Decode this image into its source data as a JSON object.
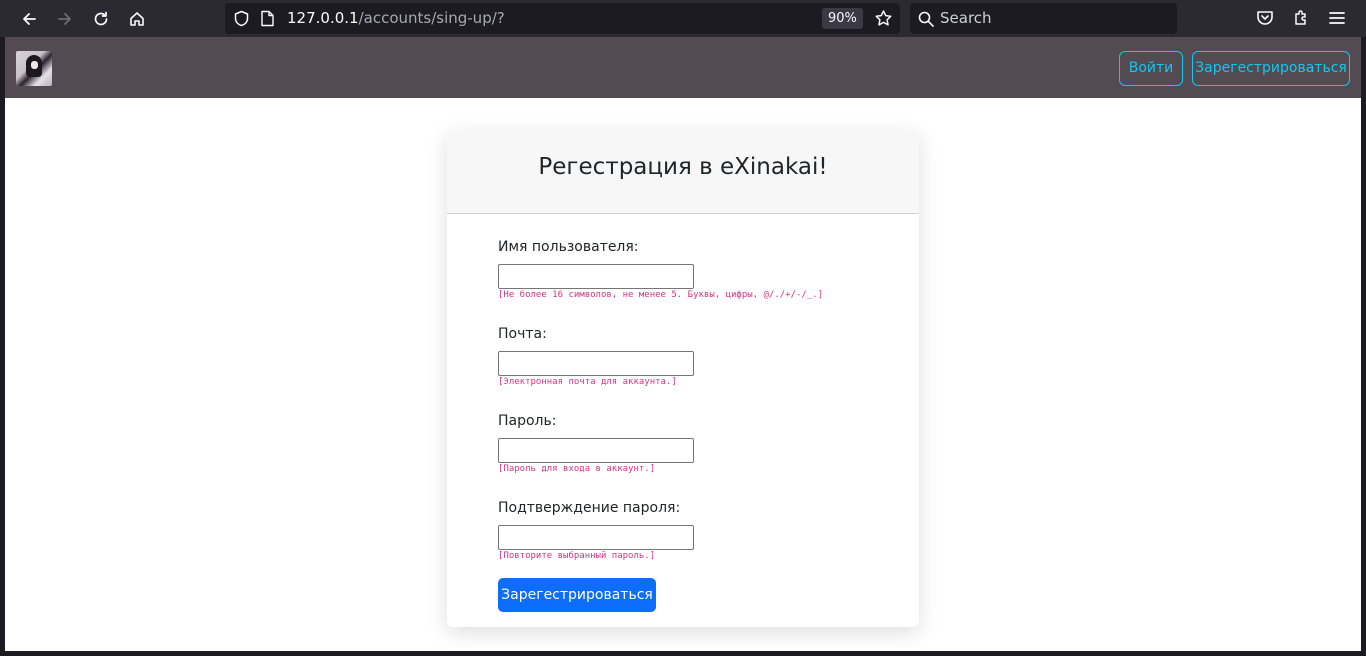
{
  "browser": {
    "url_host": "127.0.0.1",
    "url_path": "/accounts/sing-up/?",
    "zoom": "90%",
    "search_placeholder": "Search"
  },
  "navbar": {
    "login_label": "Войти",
    "register_label": "Зарегестрироваться"
  },
  "form": {
    "title": "Регестрация в eXinakai!",
    "fields": [
      {
        "label": "Имя пользователя:",
        "help": "[Не более 16 символов, не менее 5. Буквы, цифры, @/./+/-/_.]"
      },
      {
        "label": "Почта:",
        "help": "[Электронная почта для аккаунта.]"
      },
      {
        "label": "Пароль:",
        "help": "[Пароль для входа в аккаунт.]"
      },
      {
        "label": "Подтверждение пароля:",
        "help": "[Повторите выбранный пароль.]"
      }
    ],
    "submit_label": "Зарегестрироваться"
  },
  "colors": {
    "navbar_bg": "#544a52",
    "accent_outline": "#0dcaf0",
    "primary": "#0d6efd",
    "help_text": "#d63384"
  }
}
